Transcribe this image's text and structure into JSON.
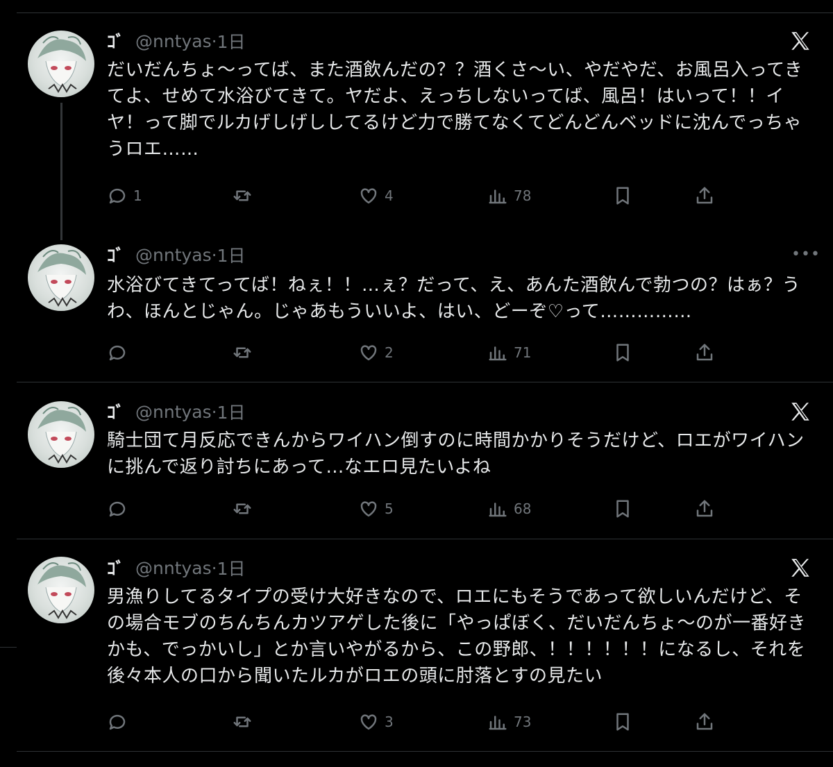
{
  "tweets": [
    {
      "name": "ｺﾞ",
      "handle": "@nntyas",
      "dot": "·",
      "time": "1日",
      "text": "だいだんちょ〜ってば、また酒飲んだの？？酒くさ〜い、やだやだ、お風呂入ってきてよ、せめて水浴びてきて。ヤだよ、えっちしないってば、風呂！はいって！！イヤ！って脚でルカげしげししてるけど力で勝てなくてどんどんベッドに沈んでっちゃうロエ……",
      "reply_count": "1",
      "retweet_count": "",
      "like_count": "4",
      "views_count": "78",
      "corner_icon": "x-logo"
    },
    {
      "name": "ｺﾞ",
      "handle": "@nntyas",
      "dot": "·",
      "time": "1日",
      "text": "水浴びてきてってば！ねぇ！！…ぇ？だって、え、あんた酒飲んで勃つの？はぁ？うわ、ほんとじゃん。じゃあもういいよ、はい、どーぞ♡って……………",
      "reply_count": "",
      "retweet_count": "",
      "like_count": "2",
      "views_count": "71",
      "corner_icon": "more-icon",
      "more_label": "•••"
    },
    {
      "name": "ｺﾞ",
      "handle": "@nntyas",
      "dot": "·",
      "time": "1日",
      "text": "騎士団て月反応できんからワイハン倒すのに時間かかりそうだけど、ロエがワイハンに挑んで返り討ちにあって…なエロ見たいよね",
      "reply_count": "",
      "retweet_count": "",
      "like_count": "5",
      "views_count": "68",
      "corner_icon": "x-logo"
    },
    {
      "name": "ｺﾞ",
      "handle": "@nntyas",
      "dot": "·",
      "time": "1日",
      "text": "男漁りしてるタイプの受け大好きなので、ロエにもそうであって欲しいんだけど、その場合モブのちんちんカツアゲした後に「やっぱぼく、だいだんちょ〜のが一番好きかも、でっかいし」とか言いやがるから、この野郎、！！！！！！になるし、それを後々本人の口から聞いたルカがロエの頭に肘落とすの見たい",
      "reply_count": "",
      "retweet_count": "",
      "like_count": "3",
      "views_count": "73",
      "corner_icon": "x-logo"
    }
  ],
  "colors": {
    "background": "#000000",
    "text": "#e7e9ea",
    "secondary": "#71767b",
    "border": "#2f3336"
  }
}
